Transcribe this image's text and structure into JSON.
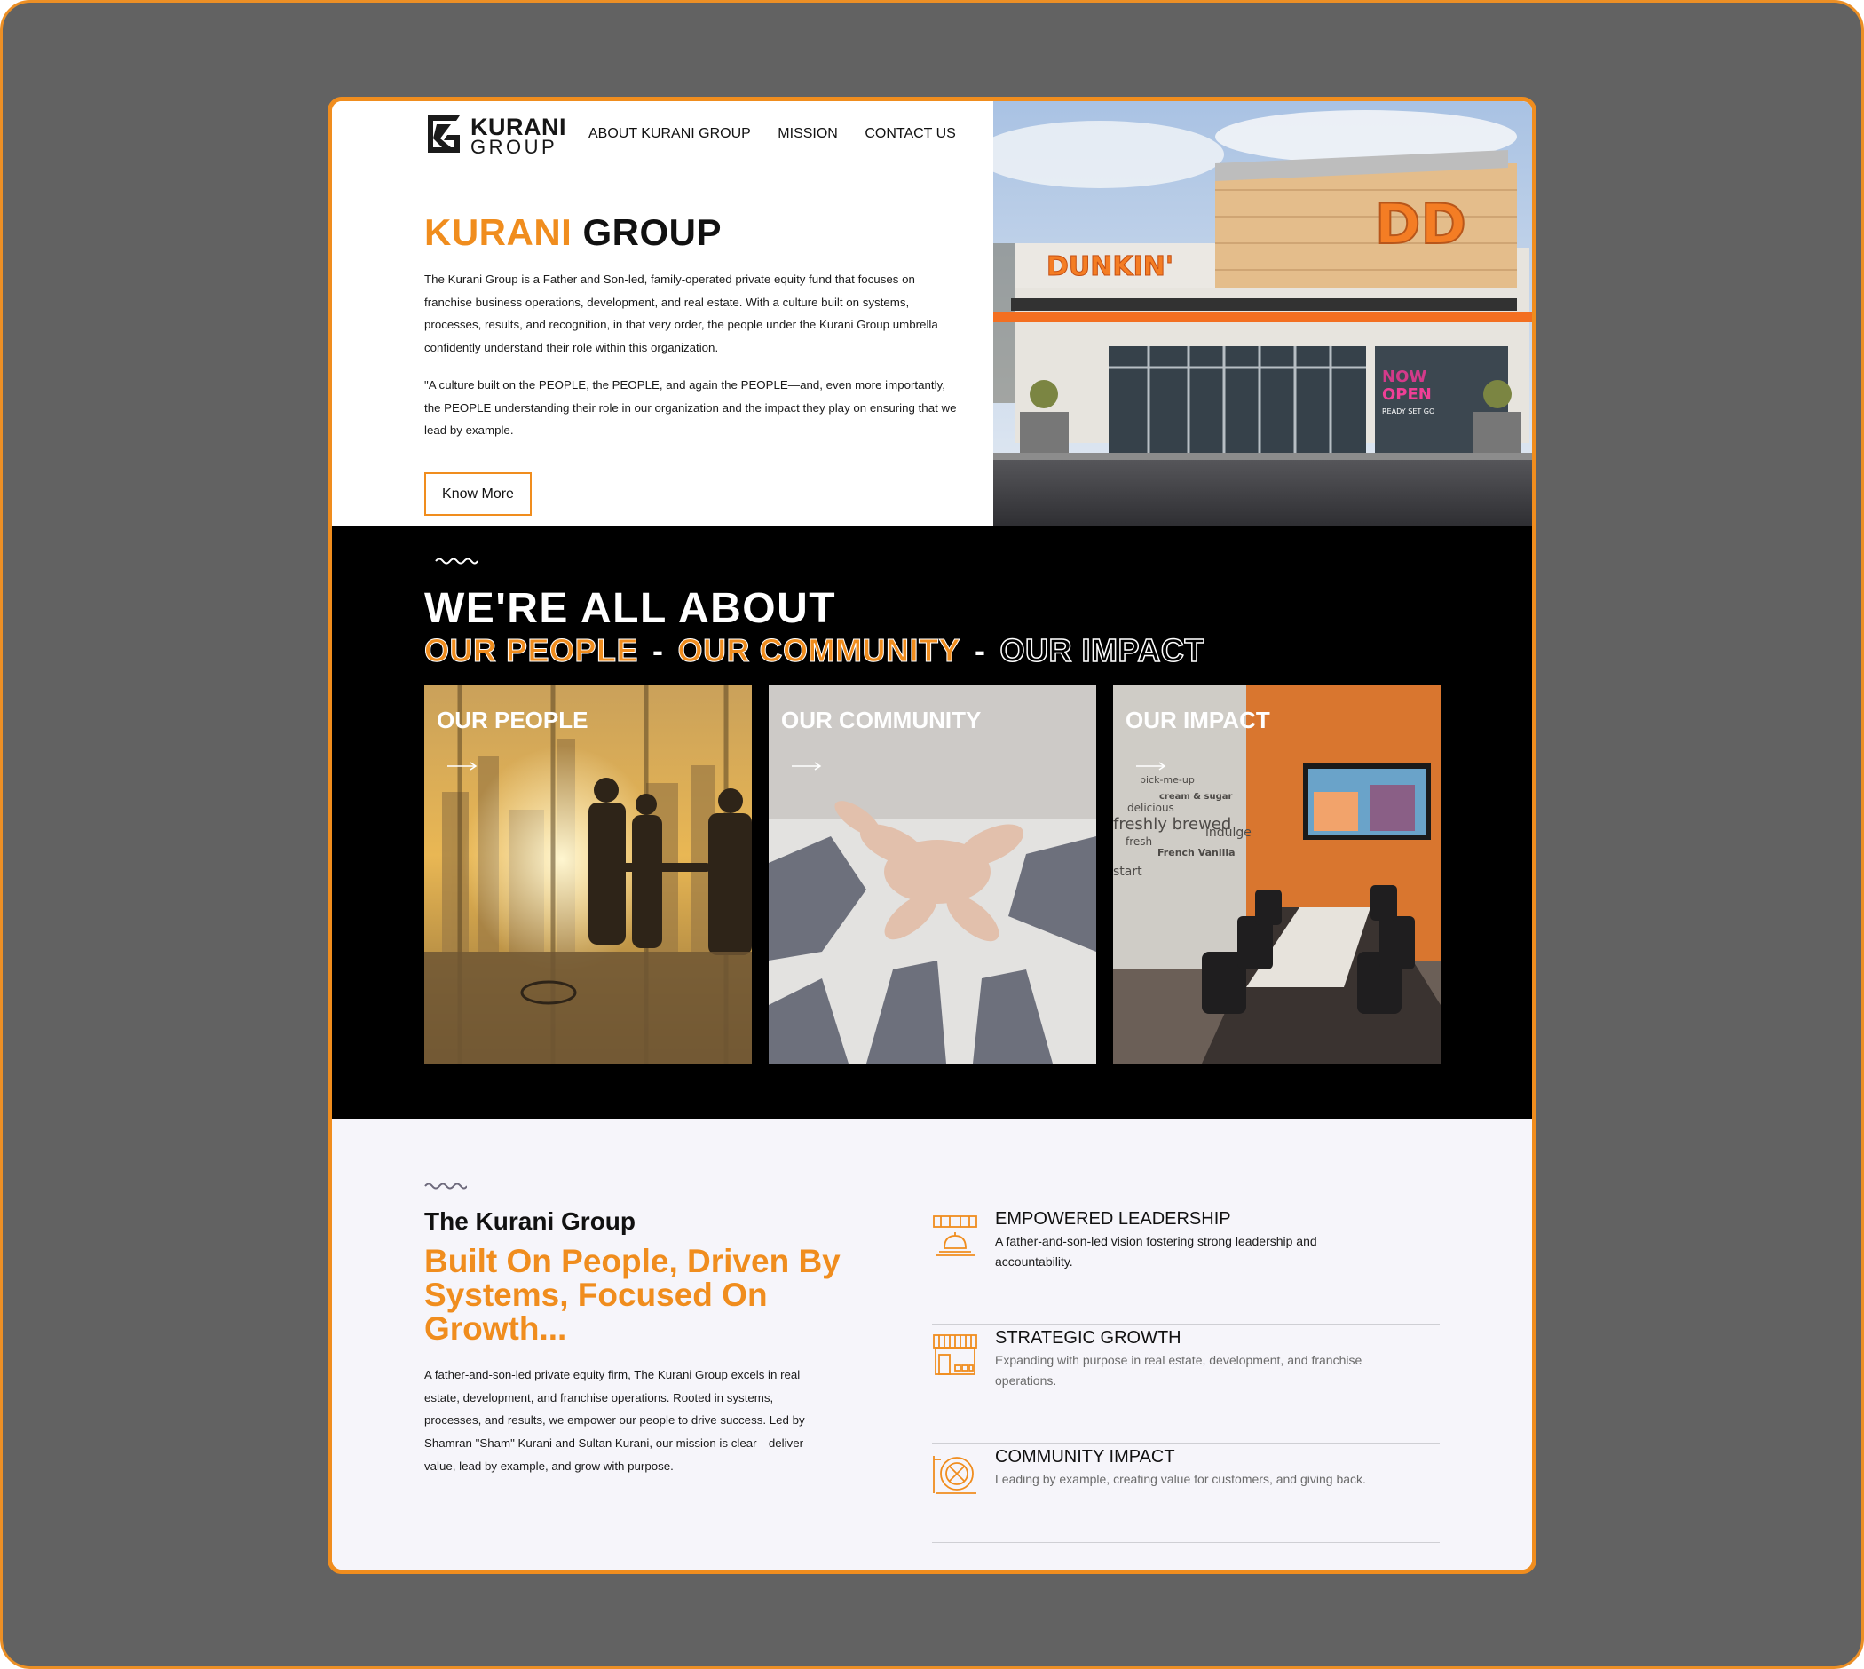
{
  "colors": {
    "accent": "#f08d1e",
    "dark": "#000000",
    "light_bg": "#f6f5fa",
    "backdrop": "#626262"
  },
  "logo": {
    "word1": "KURANI",
    "word2": "GROUP"
  },
  "nav": {
    "items": [
      "ABOUT KURANI GROUP",
      "MISSION",
      "CONTACT US"
    ]
  },
  "hero": {
    "title_accent": "KURANI",
    "title_rest": "GROUP",
    "paragraph1": "The Kurani Group is a Father and Son-led, family-operated private equity fund that focuses on franchise business operations, development, and real estate. With a culture built on systems, processes, results, and recognition, in that very order, the people under the Kurani Group umbrella confidently understand their role within this organization.",
    "paragraph2": "\"A culture built on the PEOPLE, the PEOPLE, and again the PEOPLE—and, even more importantly, the PEOPLE understanding their role in our organization and the impact they play on ensuring that we lead by example.",
    "button_label": "Know More",
    "photo": {
      "sign_text": "DUNKIN'",
      "badge_text": "DD",
      "window_line1": "NOW",
      "window_line2": "OPEN",
      "window_line3": "READY SET GO"
    }
  },
  "about": {
    "heading": "WE'RE ALL ABOUT",
    "sub1": "OUR PEOPLE",
    "separator": "-",
    "sub2": "OUR COMMUNITY",
    "sub3": "OUR IMPACT"
  },
  "cards": [
    {
      "title": "OUR PEOPLE",
      "arrow": "arrow-right-icon"
    },
    {
      "title": "OUR COMMUNITY",
      "arrow": "arrow-right-icon"
    },
    {
      "title": "OUR IMPACT",
      "arrow": "arrow-right-icon",
      "wall_words": [
        "pick-me-up",
        "cream & sugar",
        "freshly brewed",
        "indulge",
        "French Vanilla",
        "delicious",
        "fresh",
        "start"
      ]
    }
  ],
  "kurani": {
    "heading": "The Kurani Group",
    "tagline": "Built On People, Driven By Systems, Focused On Growth...",
    "paragraph": "A father-and-son-led private equity firm, The Kurani Group excels in real estate, development, and franchise operations. Rooted in systems, processes, and results, we empower our people to drive success. Led by Shamran \"Sham\" Kurani and Sultan Kurani, our mission is clear—deliver value, lead by example, and grow with purpose."
  },
  "features": [
    {
      "title": "EMPOWERED LEADERSHIP",
      "description": "A father-and-son-led vision fostering strong leadership and accountability.",
      "icon": "service-bell-icon"
    },
    {
      "title": "STRATEGIC GROWTH",
      "description": "Expanding with purpose in real estate, development, and franchise operations.",
      "icon": "storefront-icon"
    },
    {
      "title": "COMMUNITY IMPACT",
      "description": "Leading by example, creating value for customers, and giving back.",
      "icon": "dining-plate-icon"
    }
  ]
}
